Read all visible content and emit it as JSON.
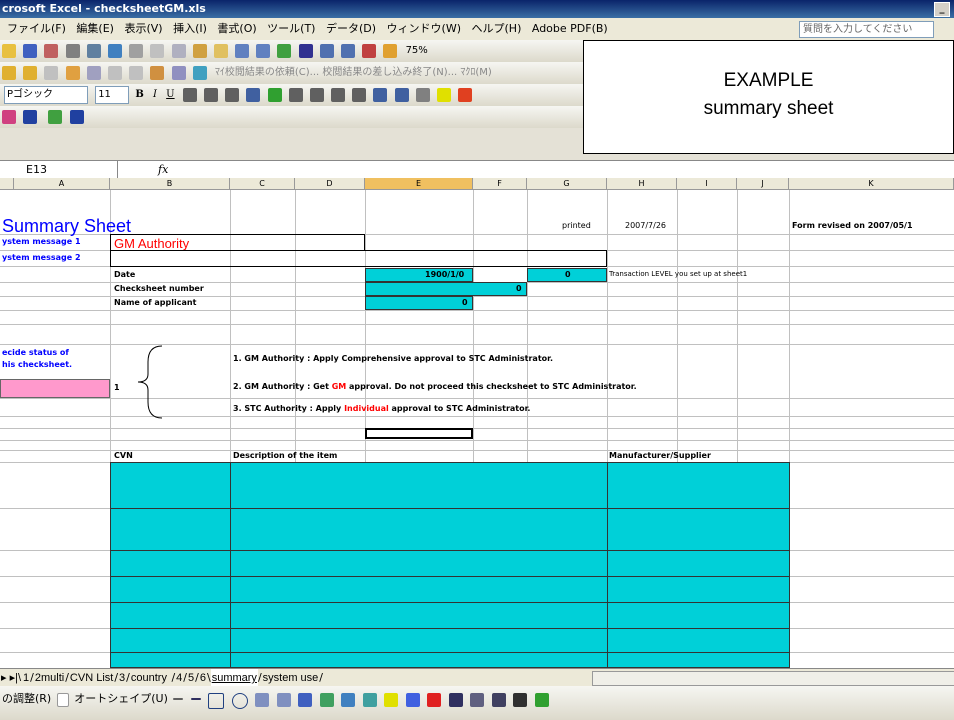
{
  "window": {
    "title": "crosoft Excel - checksheetGM.xls"
  },
  "menu": {
    "items": [
      "ファイル(F)",
      "編集(E)",
      "表示(V)",
      "挿入(I)",
      "書式(O)",
      "ツール(T)",
      "データ(D)",
      "ウィンドウ(W)",
      "ヘルプ(H)",
      "Adobe PDF(B)"
    ],
    "question_placeholder": "質問を入力してください"
  },
  "toolbar": {
    "zoom": "75%",
    "approval_text": "ﾏｲ校閲結果の依頼(C)... 校閲結果の差し込み終了(N)... ﾏｸﾛ(M)",
    "font_name": "Pゴシック",
    "font_size": "11",
    "bold": "B",
    "italic": "I",
    "underline": "U"
  },
  "formula_bar": {
    "name_box": "E13",
    "fx": "fx",
    "value": ""
  },
  "callout": {
    "line1": "EXAMPLE",
    "line2": "summary sheet"
  },
  "columns": [
    "A",
    "B",
    "C",
    "D",
    "E",
    "F",
    "G",
    "H",
    "I",
    "J",
    "K"
  ],
  "sheet": {
    "title": "Summary Sheet",
    "printed_label": "printed",
    "printed_date": "2007/7/26",
    "revised": "Form revised on 2007/05/1",
    "sysmsg1_label": "ystem message 1",
    "sysmsg1_value": "GM Authority",
    "sysmsg2_label": "ystem message 2",
    "date_label": "Date",
    "date_value": "1900/1/0",
    "level_value": "0",
    "level_note": "Transaction LEVEL you set up at sheet1",
    "checksheet_label": "Checksheet number",
    "checksheet_value": "0",
    "applicant_label": "Name of applicant",
    "applicant_value": "0",
    "decide_line1": "ecide status of",
    "decide_line2": "his checksheet.",
    "status_value": "1",
    "opt1": "1. GM Authority : Apply Comprehensive approval to STC Administrator.",
    "opt2a": "2. GM Authority : Get ",
    "opt2b": "GM",
    "opt2c": " approval.  Do not proceed this checksheet to STC Administrator.",
    "opt3a": "3. STC Authority : Apply ",
    "opt3b": "Individual",
    "opt3c": " approval to STC Administrator.",
    "table_headers": [
      "CVN",
      "Description of the item",
      "Manufacturer/Supplier"
    ]
  },
  "tabs": [
    "1",
    "2multi",
    "CVN List",
    "3",
    "country",
    "4",
    "5",
    "6",
    "summary",
    "system use"
  ],
  "active_tab": "summary",
  "drawing_bar": {
    "draw_menu": "の調整(R)",
    "autoshape": "オートシェイプ(U)"
  },
  "colors": {
    "cyan": "#00d0d8",
    "pink": "#ff99cc",
    "title_blue": "#0000ff",
    "red": "#ff0000"
  }
}
